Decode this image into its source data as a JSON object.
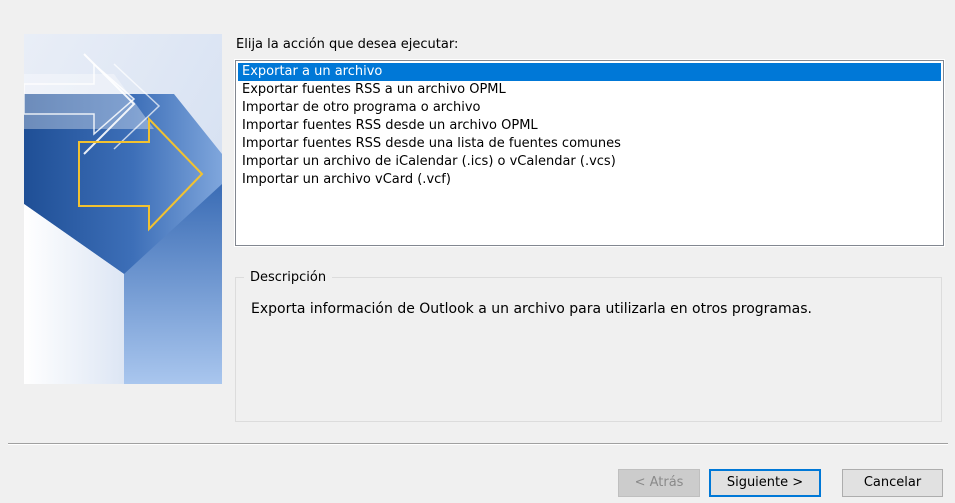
{
  "prompt_label": "Elija la acción que desea ejecutar:",
  "actions": [
    "Exportar a un archivo",
    "Exportar fuentes RSS a un archivo OPML",
    "Importar de otro programa o archivo",
    "Importar fuentes RSS desde un archivo OPML",
    "Importar fuentes RSS desde una lista de fuentes comunes",
    "Importar un archivo de iCalendar (.ics) o vCalendar (.vcs)",
    "Importar un archivo vCard (.vcf)"
  ],
  "selected_action": "Exportar a un archivo",
  "description": {
    "legend": "Descripción",
    "text": "Exporta información de Outlook a un archivo para utilizarla en otros programas."
  },
  "buttons": {
    "back": "< Atrás",
    "next": "Siguiente >",
    "cancel": "Cancelar"
  },
  "colors": {
    "selection": "#0078d7",
    "art_dark_blue": "#2b5797",
    "art_arrow_yellow": "#f2c230"
  },
  "icons": {
    "side_art": "wizard-arrows-illustration"
  }
}
